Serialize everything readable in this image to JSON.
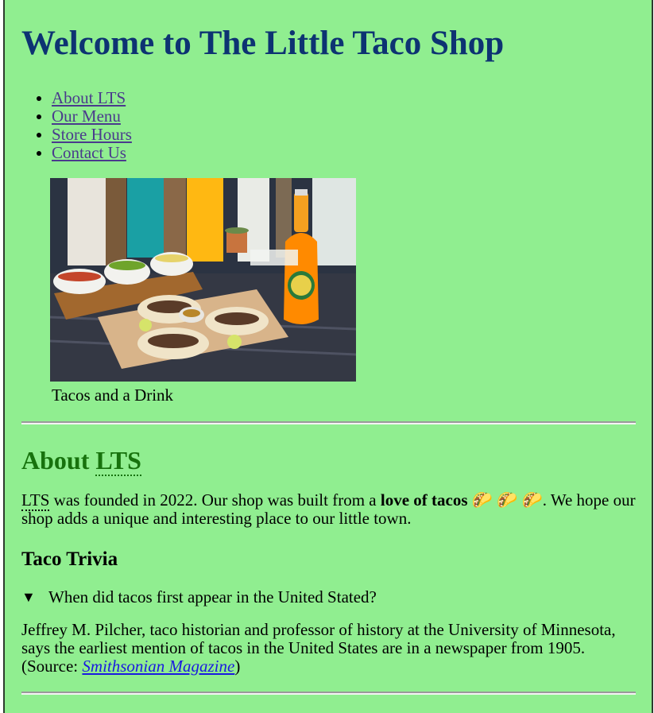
{
  "title": "Welcome to The Little Taco Shop",
  "nav": [
    {
      "label": "About LTS"
    },
    {
      "label": "Our Menu"
    },
    {
      "label": "Store Hours"
    },
    {
      "label": "Contact Us"
    }
  ],
  "figure": {
    "caption": "Tacos and a Drink"
  },
  "about": {
    "heading_prefix": "About ",
    "heading_abbr": "LTS",
    "intro": {
      "abbr": "LTS",
      "text1": " was founded in 2022. Our shop was built from a ",
      "bold": "love of tacos",
      "emoji": " 🌮 🌮 🌮",
      "text2": ". We hope our shop adds a unique and interesting place to our little town."
    }
  },
  "trivia": {
    "heading": "Taco Trivia",
    "question": "When did tacos first appear in the United Stated?",
    "answer": "Jeffrey M. Pilcher, taco historian and professor of history at the University of Minnesota, says the earliest mention of tacos in the United States are in a newspaper from 1905.",
    "source_prefix": " (Source: ",
    "source_link": "Smithsonian Magazine",
    "source_suffix": ")"
  },
  "colors": {
    "background": "#90ee90",
    "title": "#0d3372",
    "about_heading": "#17720d",
    "nav_link": "#4a3b8c",
    "source_link": "#1a1ae0"
  }
}
